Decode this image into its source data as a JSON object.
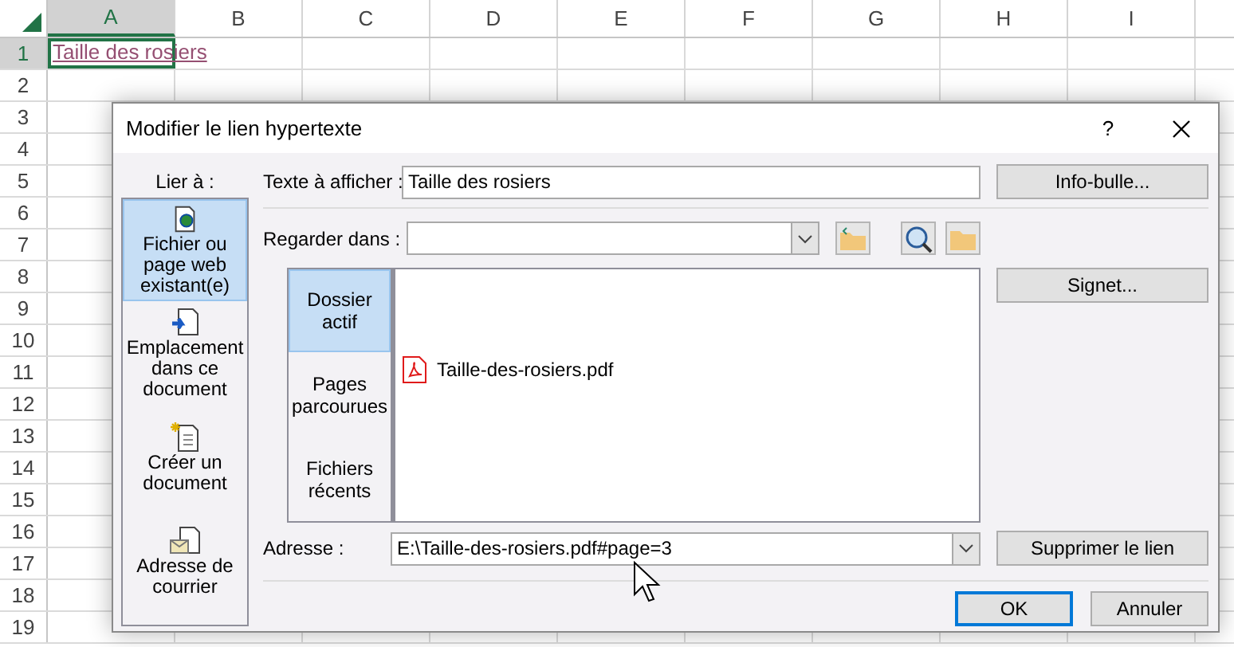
{
  "spreadsheet": {
    "columns": [
      {
        "label": "A",
        "selected": true
      },
      {
        "label": "B",
        "selected": false
      },
      {
        "label": "C",
        "selected": false
      },
      {
        "label": "D",
        "selected": false
      },
      {
        "label": "E",
        "selected": false
      },
      {
        "label": "F",
        "selected": false
      },
      {
        "label": "G",
        "selected": false
      },
      {
        "label": "H",
        "selected": false
      },
      {
        "label": "I",
        "selected": false
      }
    ],
    "rows": [
      {
        "label": "1",
        "selected": true
      },
      {
        "label": "2",
        "selected": false
      },
      {
        "label": "3",
        "selected": false
      },
      {
        "label": "4",
        "selected": false
      },
      {
        "label": "5",
        "selected": false
      },
      {
        "label": "6",
        "selected": false
      },
      {
        "label": "7",
        "selected": false
      },
      {
        "label": "8",
        "selected": false
      },
      {
        "label": "9",
        "selected": false
      },
      {
        "label": "10",
        "selected": false
      },
      {
        "label": "11",
        "selected": false
      },
      {
        "label": "12",
        "selected": false
      },
      {
        "label": "13",
        "selected": false
      },
      {
        "label": "14",
        "selected": false
      },
      {
        "label": "15",
        "selected": false
      },
      {
        "label": "16",
        "selected": false
      },
      {
        "label": "17",
        "selected": false
      },
      {
        "label": "18",
        "selected": false
      },
      {
        "label": "19",
        "selected": false
      }
    ],
    "active_cell": {
      "text": "Taille des rosiers"
    }
  },
  "dialog": {
    "title": "Modifier le lien hypertexte",
    "help": "?",
    "link_to": {
      "label": "Lier à :",
      "items": [
        {
          "label": "Fichier ou page web existant(e)",
          "kind": "file",
          "selected": true
        },
        {
          "label": "Emplacement dans ce document",
          "kind": "place",
          "selected": false
        },
        {
          "label": "Créer un document",
          "kind": "new",
          "selected": false
        },
        {
          "label": "Adresse de courrier",
          "kind": "mail",
          "selected": false
        }
      ]
    },
    "display_text": {
      "label": "Texte à afficher :",
      "value": "Taille des rosiers"
    },
    "look_in": {
      "label": "Regarder dans :"
    },
    "browse_tabs": [
      {
        "label": "Dossier actif",
        "selected": true
      },
      {
        "label": "Pages parcourues",
        "selected": false
      },
      {
        "label": "Fichiers récents",
        "selected": false
      }
    ],
    "files": [
      {
        "name": "Taille-des-rosiers.pdf",
        "kind": "pdf"
      }
    ],
    "address": {
      "label": "Adresse :",
      "value": "E:\\Taille-des-rosiers.pdf#page=3"
    },
    "side_buttons": [
      "Info-bulle...",
      "Signet...",
      "Supprimer le lien"
    ],
    "footer_buttons": [
      {
        "label": "OK",
        "default": true
      },
      {
        "label": "Annuler",
        "default": false
      }
    ]
  }
}
